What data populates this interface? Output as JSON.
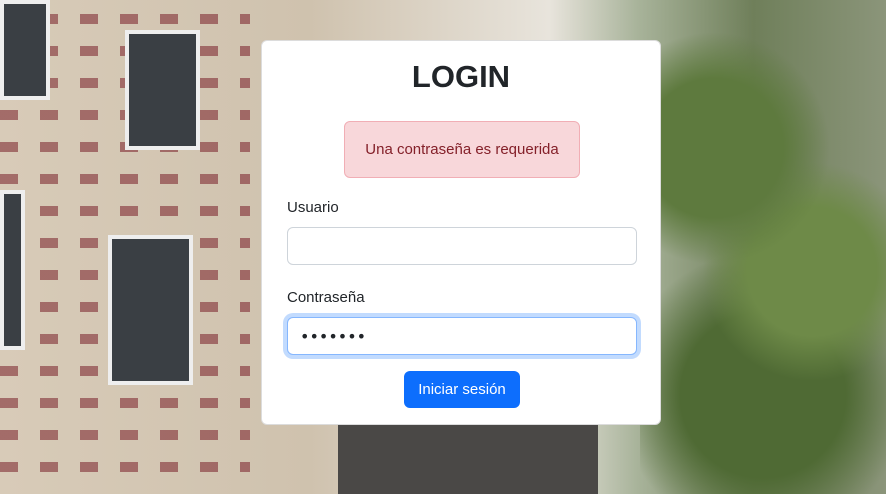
{
  "login": {
    "title": "LOGIN",
    "alert": "Una contraseña es requerida",
    "username_label": "Usuario",
    "username_value": "",
    "password_label": "Contraseña",
    "password_value": "1234567",
    "submit_label": "Iniciar sesión"
  },
  "colors": {
    "primary": "#0d6efd",
    "alert_bg": "#f8d7da",
    "alert_text": "#842029"
  }
}
